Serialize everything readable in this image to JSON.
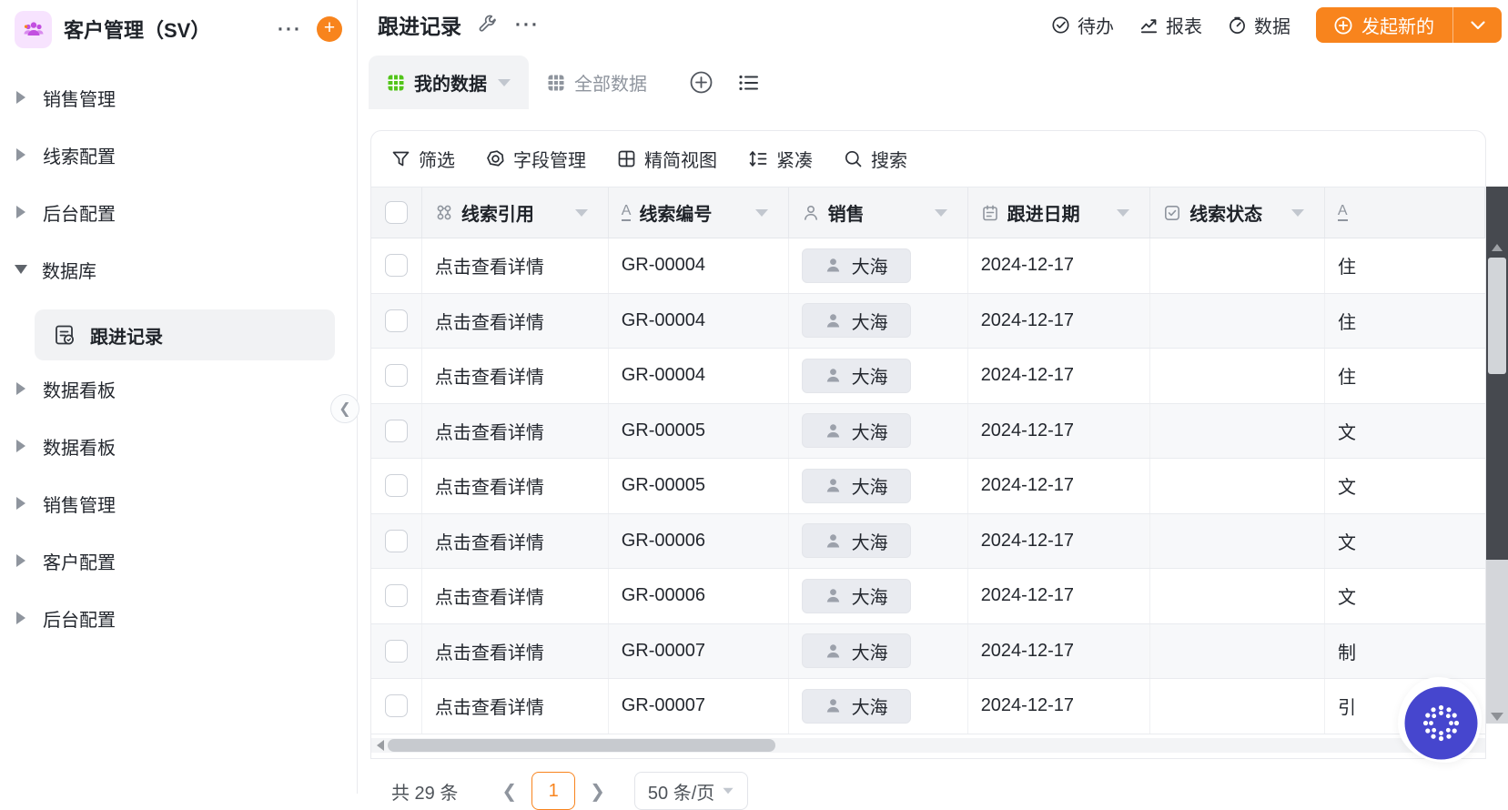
{
  "app": {
    "title": "客户管理（SV）"
  },
  "colors": {
    "accent": "#F8841D",
    "green": "#52C41A",
    "assistant_blue": "#4646CE"
  },
  "sidebar": {
    "items": [
      {
        "label": "销售管理",
        "expanded": false
      },
      {
        "label": "线索配置",
        "expanded": false
      },
      {
        "label": "后台配置",
        "expanded": false
      },
      {
        "label": "数据库",
        "expanded": true
      },
      {
        "label": "数据看板",
        "expanded": false
      },
      {
        "label": "数据看板",
        "expanded": false
      },
      {
        "label": "销售管理",
        "expanded": false
      },
      {
        "label": "客户配置",
        "expanded": false
      },
      {
        "label": "后台配置",
        "expanded": false
      }
    ],
    "selected_child": {
      "label": "跟进记录",
      "parent": "数据库"
    }
  },
  "page": {
    "title": "跟进记录"
  },
  "top_nav": {
    "items": [
      {
        "icon": "todo-icon",
        "label": "待办"
      },
      {
        "icon": "report-icon",
        "label": "报表"
      },
      {
        "icon": "data-icon",
        "label": "数据"
      }
    ],
    "primary_button": {
      "label": "发起新的"
    }
  },
  "tabs": {
    "items": [
      {
        "icon": "table-icon",
        "label": "我的数据",
        "active": true
      },
      {
        "icon": "table-icon",
        "label": "全部数据",
        "active": false
      }
    ]
  },
  "toolbar": {
    "items": [
      {
        "icon": "filter-icon",
        "label": "筛选"
      },
      {
        "icon": "field-icon",
        "label": "字段管理"
      },
      {
        "icon": "grid-icon",
        "label": "精简视图"
      },
      {
        "icon": "compact-icon",
        "label": "紧凑"
      },
      {
        "icon": "search-icon",
        "label": "搜索"
      }
    ]
  },
  "table": {
    "columns": [
      {
        "icon": "link-icon",
        "label": "线索引用"
      },
      {
        "icon": "text-icon",
        "label": "线索编号"
      },
      {
        "icon": "person-icon",
        "label": "销售"
      },
      {
        "icon": "calendar-icon",
        "label": "跟进日期"
      },
      {
        "icon": "select-icon",
        "label": "线索状态"
      },
      {
        "icon": "text-icon",
        "label": ""
      }
    ],
    "rows": [
      {
        "ref": "点击查看详情",
        "code": "GR-00004",
        "sales": "大海",
        "date": "2024-12-17",
        "status": "",
        "extra": "住"
      },
      {
        "ref": "点击查看详情",
        "code": "GR-00004",
        "sales": "大海",
        "date": "2024-12-17",
        "status": "",
        "extra": "住"
      },
      {
        "ref": "点击查看详情",
        "code": "GR-00004",
        "sales": "大海",
        "date": "2024-12-17",
        "status": "",
        "extra": "住"
      },
      {
        "ref": "点击查看详情",
        "code": "GR-00005",
        "sales": "大海",
        "date": "2024-12-17",
        "status": "",
        "extra": "文"
      },
      {
        "ref": "点击查看详情",
        "code": "GR-00005",
        "sales": "大海",
        "date": "2024-12-17",
        "status": "",
        "extra": "文"
      },
      {
        "ref": "点击查看详情",
        "code": "GR-00006",
        "sales": "大海",
        "date": "2024-12-17",
        "status": "",
        "extra": "文"
      },
      {
        "ref": "点击查看详情",
        "code": "GR-00006",
        "sales": "大海",
        "date": "2024-12-17",
        "status": "",
        "extra": "文"
      },
      {
        "ref": "点击查看详情",
        "code": "GR-00007",
        "sales": "大海",
        "date": "2024-12-17",
        "status": "",
        "extra": "制"
      },
      {
        "ref": "点击查看详情",
        "code": "GR-00007",
        "sales": "大海",
        "date": "2024-12-17",
        "status": "",
        "extra": "引"
      }
    ]
  },
  "pagination": {
    "total": "共 29 条",
    "page": "1",
    "page_size": "50 条/页"
  }
}
